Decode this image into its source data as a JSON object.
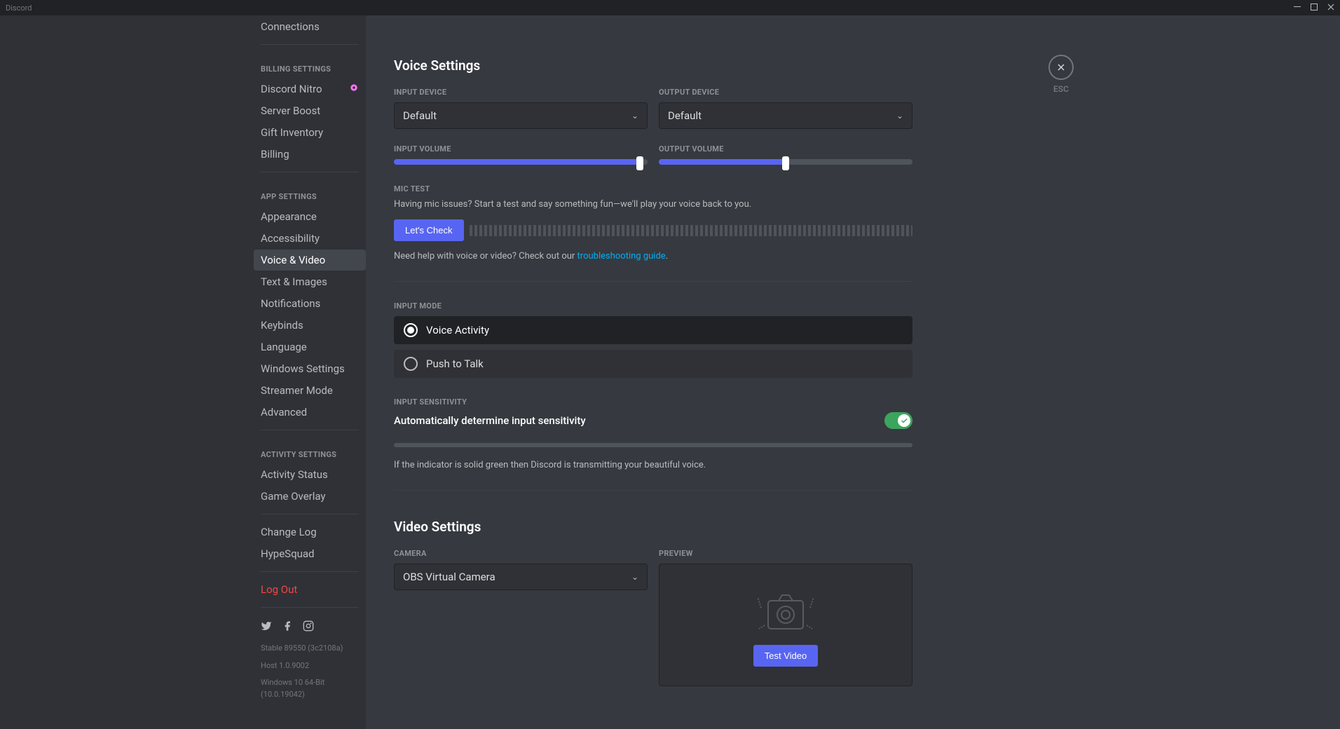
{
  "titlebar": {
    "app_name": "Discord"
  },
  "sidebar": {
    "items_top": [
      {
        "label": "Connections"
      }
    ],
    "billing_header": "BILLING SETTINGS",
    "billing_items": [
      {
        "label": "Discord Nitro",
        "badge": true
      },
      {
        "label": "Server Boost"
      },
      {
        "label": "Gift Inventory"
      },
      {
        "label": "Billing"
      }
    ],
    "app_header": "APP SETTINGS",
    "app_items": [
      {
        "label": "Appearance"
      },
      {
        "label": "Accessibility"
      },
      {
        "label": "Voice & Video",
        "selected": true
      },
      {
        "label": "Text & Images"
      },
      {
        "label": "Notifications"
      },
      {
        "label": "Keybinds"
      },
      {
        "label": "Language"
      },
      {
        "label": "Windows Settings"
      },
      {
        "label": "Streamer Mode"
      },
      {
        "label": "Advanced"
      }
    ],
    "activity_header": "ACTIVITY SETTINGS",
    "activity_items": [
      {
        "label": "Activity Status"
      },
      {
        "label": "Game Overlay"
      }
    ],
    "misc_items": [
      {
        "label": "Change Log"
      },
      {
        "label": "HypeSquad"
      }
    ],
    "logout": "Log Out",
    "version_lines": [
      "Stable 89550 (3c2108a)",
      "Host 1.0.9002",
      "Windows 10 64-Bit (10.0.19042)"
    ]
  },
  "close": {
    "esc": "ESC"
  },
  "voice": {
    "heading": "Voice Settings",
    "input_device_label": "INPUT DEVICE",
    "input_device_value": "Default",
    "output_device_label": "OUTPUT DEVICE",
    "output_device_value": "Default",
    "input_volume_label": "INPUT VOLUME",
    "input_volume_pct": 97,
    "output_volume_label": "OUTPUT VOLUME",
    "output_volume_pct": 50,
    "mic_test_label": "MIC TEST",
    "mic_test_desc": "Having mic issues? Start a test and say something fun—we'll play your voice back to you.",
    "mic_test_btn": "Let's Check",
    "help_text_prefix": "Need help with voice or video? Check out our ",
    "help_link": "troubleshooting guide",
    "help_text_suffix": ".",
    "input_mode_label": "INPUT MODE",
    "mode_voice_activity": "Voice Activity",
    "mode_push_to_talk": "Push to Talk",
    "sensitivity_label": "INPUT SENSITIVITY",
    "auto_sensitivity_label": "Automatically determine input sensitivity",
    "sensitivity_note": "If the indicator is solid green then Discord is transmitting your beautiful voice."
  },
  "video": {
    "heading": "Video Settings",
    "camera_label": "CAMERA",
    "camera_value": "OBS Virtual Camera",
    "preview_label": "PREVIEW",
    "test_btn": "Test Video"
  }
}
